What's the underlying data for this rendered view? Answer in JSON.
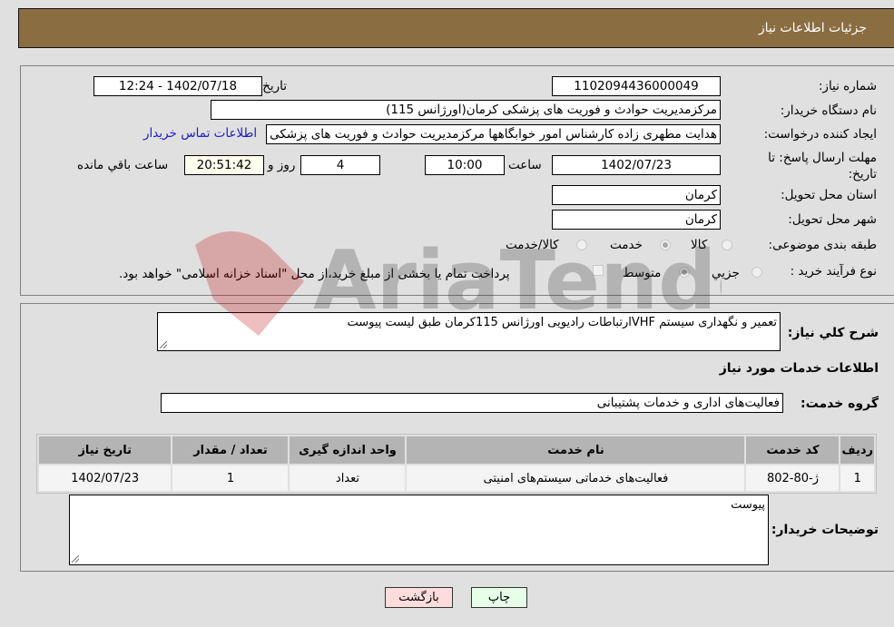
{
  "header": {
    "title": "جزئیات اطلاعات نیاز"
  },
  "details": {
    "need_number_label": "شماره نیاز:",
    "need_number": "1102094436000049",
    "announce_label": "تاريخ و ساعت اعلان عمومي:",
    "announce_value": "1402/07/18 - 12:24",
    "buyer_org_label": "نام دستگاه خريدار:",
    "buyer_org": "مرکزمدیریت  حوادث و فوریت های پزشکی کرمان(اورژانس 115)",
    "creator_label": "ايجاد کننده درخواست:",
    "creator": "هدایت مطهری زاده کارشناس امور خوابگاهها مرکزمدیریت  حوادث و فوریت های پزشکی کرمان",
    "contact_link": "اطلاعات تماس خريدار",
    "deadline_label": "مهلت ارسال پاسخ: تا تاريخ:",
    "deadline_date": "1402/07/23",
    "time_label": "ساعت",
    "deadline_time": "10:00",
    "days_value": "4",
    "days_label": "روز و",
    "remaining_time": "20:51:42",
    "remaining_label": "ساعت باقي مانده",
    "province_label": "استان محل تحويل:",
    "province": "کرمان",
    "city_label": "شهر محل تحويل:",
    "city": "کرمان",
    "category_label": "طبقه بندی موضوعی:",
    "category_options": [
      {
        "label": "کالا",
        "selected": false
      },
      {
        "label": "خدمت",
        "selected": true
      },
      {
        "label": "کالا/خدمت",
        "selected": false
      }
    ],
    "purchase_type_label": "نوع فرآيند خريد :",
    "purchase_options": [
      {
        "label": "جزيي",
        "selected": false
      },
      {
        "label": "متوسط",
        "selected": true
      }
    ],
    "treasury_checkbox_label": "پرداخت تمام يا بخشی از مبلغ خريد،از محل \"اسناد خزانه اسلامی\" خواهد بود.",
    "treasury_checked": false
  },
  "services": {
    "description_label": "شرح کلي نياز:",
    "description": "تعمیر و نگهداری سیستم VHFارتباطات رادیویی اورژانس 115کرمان طبق لیست پیوست",
    "section_title": "اطلاعات خدمات مورد نياز",
    "group_label": "گروه خدمت:",
    "group_value": "فعالیت‌های اداری و خدمات پشتیبانی",
    "table": {
      "headers": [
        "رديف",
        "کد خدمت",
        "نام خدمت",
        "واحد اندازه گيری",
        "تعداد / مقدار",
        "تاريخ نياز"
      ],
      "rows": [
        [
          "1",
          "ژ-80-802",
          "فعالیت‌های خدماتی سیستم‌های امنیتی",
          "تعداد",
          "1",
          "1402/07/23"
        ]
      ]
    },
    "buyer_notes_label": "توضيحات خريدار:",
    "buyer_notes": "پیوست"
  },
  "actions": {
    "print_label": "چاپ",
    "back_label": "بازگشت"
  },
  "colors": {
    "header_bg": "#8b6d42",
    "link": "#1a1acc",
    "print_bg": "#e6ffe6",
    "back_bg": "#ffdcdc"
  },
  "watermark": {
    "text": "AriaTender.neT"
  }
}
